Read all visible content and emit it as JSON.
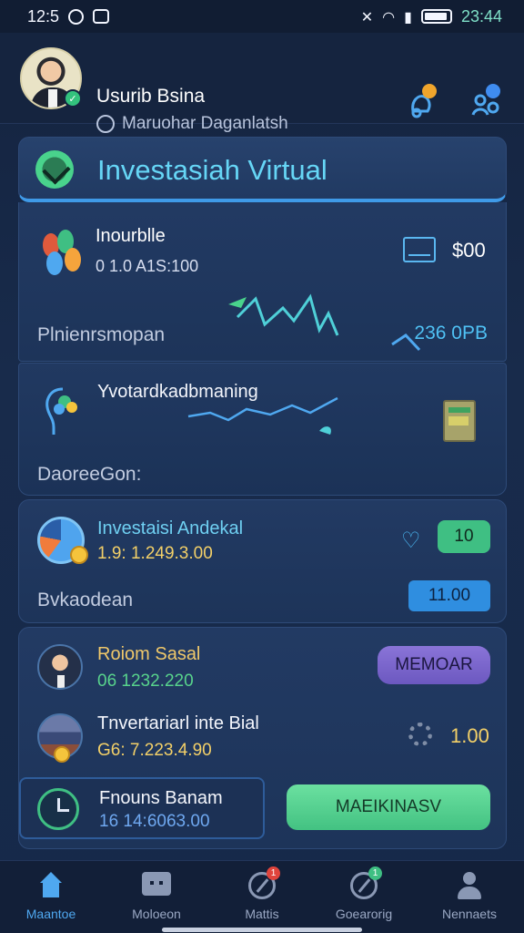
{
  "status_bar": {
    "left_time": "12:5",
    "right_time": "23:44"
  },
  "header": {
    "user_name": "Usurib Bsina",
    "user_subtitle": "Maruohar Daganlatsh"
  },
  "title_card": {
    "title": "Investasiah Virtual"
  },
  "main_card": {
    "asset_title": "Inourblle",
    "asset_value": "0 1.0 A1S:100",
    "balance": "$00",
    "footer_label": "Plnienrsmopan",
    "footer_value": "236 0PB"
  },
  "trend_card": {
    "title": "Yvotardkadbmaning",
    "footer_label": "DaoreeGon:"
  },
  "invest_card": {
    "title": "Investaisi Andekal",
    "value": "1.9: 1.249.3.00",
    "badge_value": "10",
    "footer_label": "Bvkaodean",
    "footer_button": "11.00"
  },
  "people_card": {
    "person1_name": "Roiom Sasal",
    "person1_value": "06 1232.220",
    "person1_button": "MEMOAR",
    "person2_name": "Tnvertariarl inte Bial",
    "person2_value": "G6: 7.223.4.90",
    "person2_amount": "1.00",
    "fund_title": "Fnouns Banam",
    "fund_value": "16 14:6063.00",
    "fund_button": "MAEIKINASV"
  },
  "tabbar": {
    "tabs": [
      {
        "label": "Maantoe"
      },
      {
        "label": "Moloeon"
      },
      {
        "label": "Mattis",
        "badge": "1"
      },
      {
        "label": "Goearorig",
        "badge": "1"
      },
      {
        "label": "Nennaets"
      }
    ]
  },
  "colors": {
    "accent_blue": "#4fa8f0",
    "accent_green": "#3fbf83",
    "accent_purple": "#7c66cc",
    "gold": "#f3d068",
    "background": "#16294a"
  }
}
